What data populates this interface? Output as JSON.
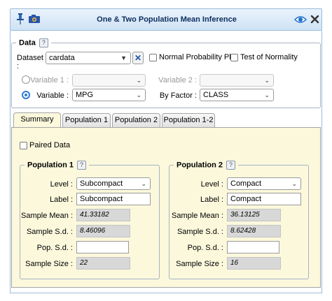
{
  "window": {
    "title": "One & Two Population Mean Inference"
  },
  "data_group": {
    "legend": "Data",
    "help": "?",
    "dataset_label": "Dataset :",
    "dataset_value": "cardata",
    "clear_symbol": "✕",
    "normal_probability_plot": {
      "label": "Normal Probability Plot",
      "checked": false
    },
    "test_of_normality": {
      "label": "Test of Normality",
      "checked": false
    },
    "variable1_label": "Variable 1 :",
    "variable1_value": "",
    "variable2_label": "Variable 2 :",
    "variable2_value": "",
    "variable_label": "Variable :",
    "variable_value": "MPG",
    "by_factor_label": "By Factor :",
    "by_factor_value": "CLASS"
  },
  "tabs": [
    {
      "label": "Summary",
      "active": true
    },
    {
      "label": "Population 1",
      "active": false
    },
    {
      "label": "Population 2",
      "active": false
    },
    {
      "label": "Population 1-2",
      "active": false
    }
  ],
  "summary": {
    "paired_data": {
      "label": "Paired Data",
      "checked": false
    },
    "population1": {
      "legend": "Population 1",
      "level_label": "Level :",
      "level_value": "Subcompact",
      "label_label": "Label :",
      "label_value": "Subcompact",
      "sample_mean_label": "Sample Mean :",
      "sample_mean": "41.33182",
      "sample_sd_label": "Sample S.d. :",
      "sample_sd": "8.46096",
      "pop_sd_label": "Pop. S.d. :",
      "pop_sd": "",
      "sample_size_label": "Sample Size :",
      "sample_size": "22"
    },
    "population2": {
      "legend": "Population 2",
      "level_label": "Level :",
      "level_value": "Compact",
      "label_label": "Label :",
      "label_value": "Compact",
      "sample_mean_label": "Sample Mean :",
      "sample_mean": "36.13125",
      "sample_sd_label": "Sample S.d. :",
      "sample_sd": "8.62428",
      "pop_sd_label": "Pop. S.d. :",
      "pop_sd": "",
      "sample_size_label": "Sample Size :",
      "sample_size": "16"
    }
  },
  "colors": {
    "title_text": "#0d2e5e",
    "panel_bg": "#fbf8dc",
    "accent": "#2f7ad8"
  },
  "icons": [
    "pin-icon",
    "camera-icon",
    "eye-icon",
    "close-icon"
  ]
}
